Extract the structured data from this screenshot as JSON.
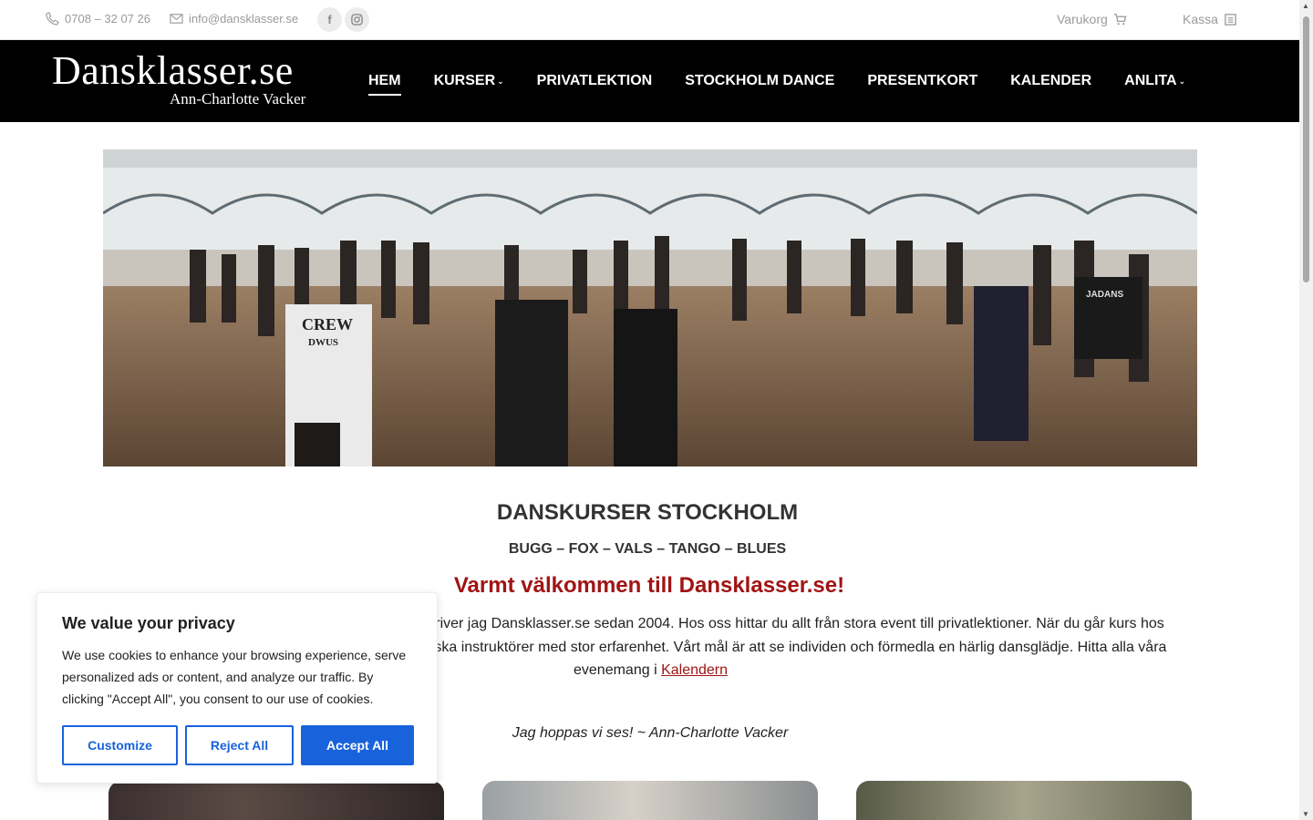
{
  "topbar": {
    "phone": "0708 – 32 07 26",
    "email": "info@dansklasser.se",
    "cart_label": "Varukorg",
    "checkout_label": "Kassa"
  },
  "header": {
    "logo_main": "Dansklasser.se",
    "logo_sub": "Ann-Charlotte Vacker",
    "nav": [
      {
        "label": "HEM"
      },
      {
        "label": "KURSER"
      },
      {
        "label": "PRIVATLEKTION"
      },
      {
        "label": "STOCKHOLM DANCE"
      },
      {
        "label": "PRESENTKORT"
      },
      {
        "label": "KALENDER"
      },
      {
        "label": "ANLITA"
      }
    ]
  },
  "hero": {
    "shirt_text_1": "CREW",
    "shirt_text_2": "DWUS",
    "shirt_text_3": "JADANS"
  },
  "content": {
    "title": "DANSKURSER STOCKHOLM",
    "subtitle": "BUGG – FOX – VALS – TANGO – BLUES",
    "welcome": "Varmt välkommen till Dansklasser.se!",
    "intro_line1": "n driver jag Dansklasser.se sedan 2004. Hos oss hittar du allt från stora event till privatlektioner. När du går kurs hos",
    "intro_line2": "ogiska instruktörer med stor erfarenhet. Vårt mål är att se individen och förmedla en härlig dansglädje. Hitta alla våra",
    "intro_line3": "evenemang i",
    "calendar_link": "Kalendern",
    "signoff": "Jag hoppas vi ses!  ~ Ann-Charlotte Vacker"
  },
  "cookie": {
    "title": "We value your privacy",
    "text": "We use cookies to enhance your browsing experience, serve personalized ads or content, and analyze our traffic. By clicking \"Accept All\", you consent to our use of cookies.",
    "customize": "Customize",
    "reject": "Reject All",
    "accept": "Accept All"
  },
  "colors": {
    "accent_red": "#a01414",
    "cookie_blue": "#1863dc",
    "header_bg": "#000000"
  }
}
